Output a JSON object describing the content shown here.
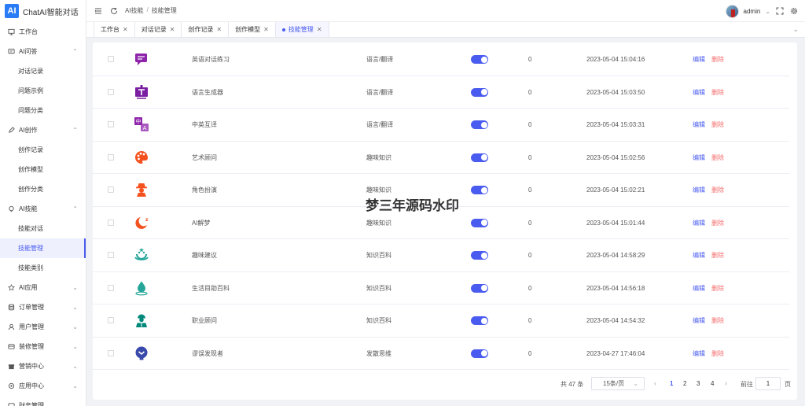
{
  "brand": {
    "logo": "AI",
    "title": "ChatAI智能对话"
  },
  "header": {
    "breadcrumb": [
      "AI技能",
      "技能管理"
    ],
    "username": "admin"
  },
  "sidebar": {
    "items": [
      {
        "label": "工作台",
        "icon": "monitor-icon",
        "type": "top"
      },
      {
        "label": "AI问答",
        "icon": "chat-icon",
        "type": "group",
        "chev": "⌃"
      },
      {
        "label": "对话记录",
        "type": "sub"
      },
      {
        "label": "问题示例",
        "type": "sub"
      },
      {
        "label": "问题分类",
        "type": "sub"
      },
      {
        "label": "AI创作",
        "icon": "pen-icon",
        "type": "group",
        "chev": "⌃"
      },
      {
        "label": "创作记录",
        "type": "sub"
      },
      {
        "label": "创作模型",
        "type": "sub"
      },
      {
        "label": "创作分类",
        "type": "sub"
      },
      {
        "label": "AI技能",
        "icon": "bulb-icon",
        "type": "group",
        "chev": "⌃"
      },
      {
        "label": "技能对话",
        "type": "sub"
      },
      {
        "label": "技能管理",
        "type": "sub",
        "active": true
      },
      {
        "label": "技能类别",
        "type": "sub"
      },
      {
        "label": "AI应用",
        "icon": "star-icon",
        "type": "group",
        "chev": "⌄"
      },
      {
        "label": "订单管理",
        "icon": "database-icon",
        "type": "group",
        "chev": "⌄"
      },
      {
        "label": "用户管理",
        "icon": "user-icon",
        "type": "group",
        "chev": "⌄"
      },
      {
        "label": "装修管理",
        "icon": "brush-icon",
        "type": "group",
        "chev": "⌄"
      },
      {
        "label": "营销中心",
        "icon": "gift-icon",
        "type": "group",
        "chev": "⌄"
      },
      {
        "label": "应用中心",
        "icon": "apps-icon",
        "type": "group",
        "chev": "⌄"
      },
      {
        "label": "财务管理",
        "icon": "wallet-icon",
        "type": "group",
        "chev": "⌄"
      }
    ]
  },
  "tabs": [
    {
      "label": "工作台",
      "active": false
    },
    {
      "label": "对话记录",
      "active": false
    },
    {
      "label": "创作记录",
      "active": false
    },
    {
      "label": "创作模型",
      "active": false
    },
    {
      "label": "技能管理",
      "active": true
    }
  ],
  "table": {
    "rows": [
      {
        "name": "英语对话练习",
        "category": "语言/翻译",
        "count": "0",
        "time": "2023-05-04 15:04:16",
        "icon": "chat-bubble-icon",
        "color": "#8e24aa"
      },
      {
        "name": "语言生成器",
        "category": "语言/翻译",
        "count": "0",
        "time": "2023-05-04 15:03:50",
        "icon": "text-board-icon",
        "color": "#7b1fa2"
      },
      {
        "name": "中英互译",
        "category": "语言/翻译",
        "count": "0",
        "time": "2023-05-04 15:03:31",
        "icon": "translate-icon",
        "color": "#8e24aa"
      },
      {
        "name": "艺术顾问",
        "category": "趣味知识",
        "count": "0",
        "time": "2023-05-04 15:02:56",
        "icon": "palette-icon",
        "color": "#f4511e"
      },
      {
        "name": "角色扮演",
        "category": "趣味知识",
        "count": "0",
        "time": "2023-05-04 15:02:21",
        "icon": "detective-icon",
        "color": "#f4511e"
      },
      {
        "name": "AI解梦",
        "category": "趣味知识",
        "count": "0",
        "time": "2023-05-04 15:01:44",
        "icon": "moon-icon",
        "color": "#f4511e"
      },
      {
        "name": "趣味建议",
        "category": "知识百科",
        "count": "0",
        "time": "2023-05-04 14:58:29",
        "icon": "smile-icon",
        "color": "#26a69a"
      },
      {
        "name": "生活目助百科",
        "category": "知识百科",
        "count": "0",
        "time": "2023-05-04 14:56:18",
        "icon": "water-drop-icon",
        "color": "#26a69a"
      },
      {
        "name": "职业顾问",
        "category": "知识百科",
        "count": "0",
        "time": "2023-05-04 14:54:32",
        "icon": "worker-icon",
        "color": "#00897b"
      },
      {
        "name": "谬误发现者",
        "category": "发散思维",
        "count": "0",
        "time": "2023-04-27 17:46:04",
        "icon": "bulb-chevron-icon",
        "color": "#3949ab"
      }
    ],
    "edit_label": "编辑",
    "delete_label": "删除"
  },
  "watermark": "梦三年源码水印",
  "pagination": {
    "total": "共 47 条",
    "page_size": "15条/页",
    "pages": [
      "1",
      "2",
      "3",
      "4"
    ],
    "current": "1",
    "goto_label": "前往",
    "goto_value": "1",
    "goto_unit": "页"
  },
  "colors": {
    "accent": "#4a5bef",
    "danger": "#f56c6c"
  }
}
